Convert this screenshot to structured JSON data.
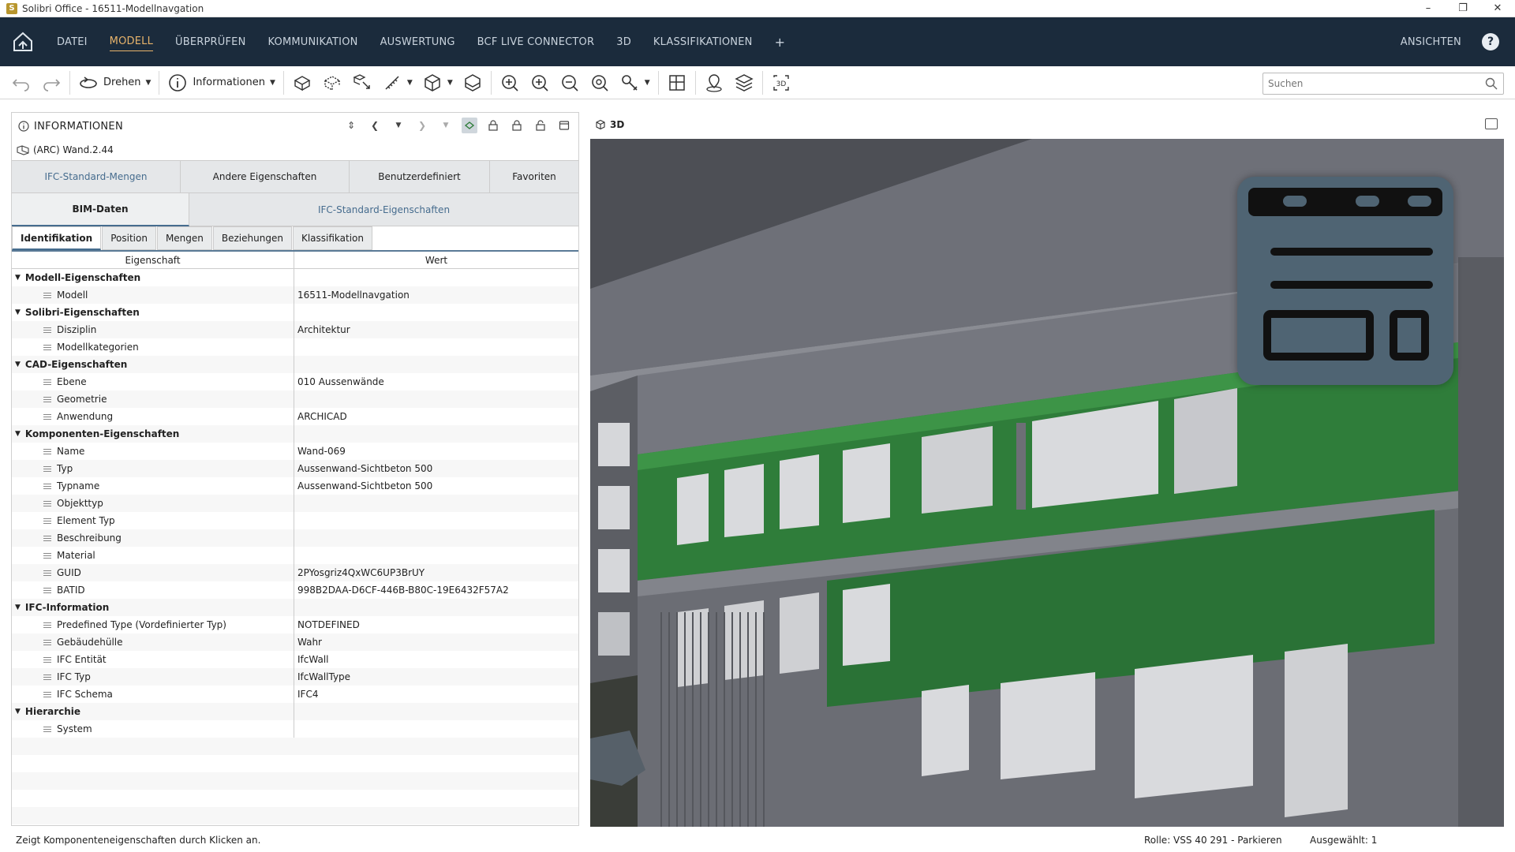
{
  "window": {
    "title": "Solibri Office - 16511-Modellnavgation",
    "app_icon": "S"
  },
  "menu": {
    "items": [
      "DATEI",
      "MODELL",
      "ÜBERPRÜFEN",
      "KOMMUNIKATION",
      "AUSWERTUNG",
      "BCF LIVE CONNECTOR",
      "3D",
      "KLASSIFIKATIONEN"
    ],
    "active": "MODELL",
    "add": "+",
    "right_label": "ANSICHTEN",
    "help": "?"
  },
  "toolbar": {
    "rotate_label": "Drehen",
    "info_label": "Informationen",
    "icons": [
      "undo-icon",
      "redo-icon",
      "rotate-icon",
      "info-icon",
      "visibility-icon",
      "hide-icon",
      "select-icon",
      "measure-icon",
      "cube-view-icon",
      "section-box-icon",
      "zoom-fit-icon",
      "zoom-in-icon",
      "zoom-out-icon",
      "zoom-selected-icon",
      "pick-icon",
      "floor-plan-icon",
      "location-icon",
      "layers-icon",
      "view-3d-icon"
    ]
  },
  "search": {
    "placeholder": "Suchen"
  },
  "info_panel": {
    "title": "INFORMATIONEN",
    "selected_object": "(ARC) Wand.2.44",
    "tabs_row1": [
      "IFC-Standard-Mengen",
      "Andere Eigenschaften",
      "Benutzerdefiniert",
      "Favoriten"
    ],
    "tabs_row2": [
      "BIM-Daten",
      "IFC-Standard-Eigenschaften"
    ],
    "tabs_row3": [
      "Identifikation",
      "Position",
      "Mengen",
      "Beziehungen",
      "Klassifikation"
    ],
    "col_property": "Eigenschaft",
    "col_value": "Wert",
    "groups": [
      {
        "name": "Modell-Eigenschaften",
        "rows": [
          {
            "k": "Modell",
            "v": "16511-Modellnavgation"
          }
        ]
      },
      {
        "name": "Solibri-Eigenschaften",
        "rows": [
          {
            "k": "Disziplin",
            "v": "Architektur"
          },
          {
            "k": "Modellkategorien",
            "v": ""
          }
        ]
      },
      {
        "name": "CAD-Eigenschaften",
        "rows": [
          {
            "k": "Ebene",
            "v": "010 Aussenwände"
          },
          {
            "k": "Geometrie",
            "v": ""
          },
          {
            "k": "Anwendung",
            "v": "ARCHICAD"
          }
        ]
      },
      {
        "name": "Komponenten-Eigenschaften",
        "rows": [
          {
            "k": "Name",
            "v": "Wand-069"
          },
          {
            "k": "Typ",
            "v": "Aussenwand-Sichtbeton 500"
          },
          {
            "k": "Typname",
            "v": "Aussenwand-Sichtbeton 500"
          },
          {
            "k": "Objekttyp",
            "v": ""
          },
          {
            "k": "Element Typ",
            "v": ""
          },
          {
            "k": "Beschreibung",
            "v": ""
          },
          {
            "k": "Material",
            "v": ""
          },
          {
            "k": "GUID",
            "v": "2PYosgriz4QxWC6UP3BrUY"
          },
          {
            "k": "BATID",
            "v": "998B2DAA-D6CF-446B-B80C-19E6432F57A2"
          }
        ]
      },
      {
        "name": "IFC-Information",
        "rows": [
          {
            "k": "Predefined Type (Vordefinierter Typ)",
            "v": "NOTDEFINED"
          },
          {
            "k": "Gebäudehülle",
            "v": "Wahr"
          },
          {
            "k": "IFC Entität",
            "v": "IfcWall"
          },
          {
            "k": "IFC Typ",
            "v": "IfcWallType"
          },
          {
            "k": "IFC Schema",
            "v": "IFC4"
          }
        ]
      },
      {
        "name": "Hierarchie",
        "rows": [
          {
            "k": "System",
            "v": ""
          }
        ]
      }
    ]
  },
  "view": {
    "label": "3D"
  },
  "statusbar": {
    "message": "Zeigt Komponenteneigenschaften durch Klicken an.",
    "role": "Rolle: VSS 40 291 - Parkieren",
    "selected": "Ausgewählt: 1"
  },
  "colors": {
    "menubar": "#1b2b3c",
    "accent": "#e7b36b",
    "highlight_wall": "#2f7d3a",
    "overlay_card": "#4f6473"
  }
}
